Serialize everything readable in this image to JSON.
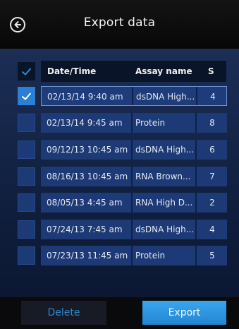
{
  "header": {
    "title": "Export data"
  },
  "table": {
    "columns": [
      "Date/Time",
      "Assay name",
      "S"
    ],
    "rows": [
      {
        "date": "02/13/14 9:40 am",
        "assay": "dsDNA High...",
        "s": "4",
        "checked": true
      },
      {
        "date": "02/13/14 9:45 am",
        "assay": "Protein",
        "s": "8",
        "checked": false
      },
      {
        "date": "09/12/13 10:45 am",
        "assay": "dsDNA High...",
        "s": "6",
        "checked": false
      },
      {
        "date": "08/16/13 10:45 am",
        "assay": "RNA Brown...",
        "s": "7",
        "checked": false
      },
      {
        "date": "08/05/13 4:45 am",
        "assay": "RNA High D...",
        "s": "2",
        "checked": false
      },
      {
        "date": "07/24/13 7:45 am",
        "assay": "dsDNA High...",
        "s": "4",
        "checked": false
      },
      {
        "date": "07/23/13 11:45 am",
        "assay": "Protein",
        "s": "5",
        "checked": false
      }
    ]
  },
  "footer": {
    "delete_label": "Delete",
    "export_label": "Export"
  },
  "colors": {
    "accent": "#2b7fd7",
    "row_bg": "#1d3a77",
    "header_bg": "#0a1428"
  },
  "icons": {
    "back": "back-arrow-icon",
    "check": "checkmark-icon"
  }
}
